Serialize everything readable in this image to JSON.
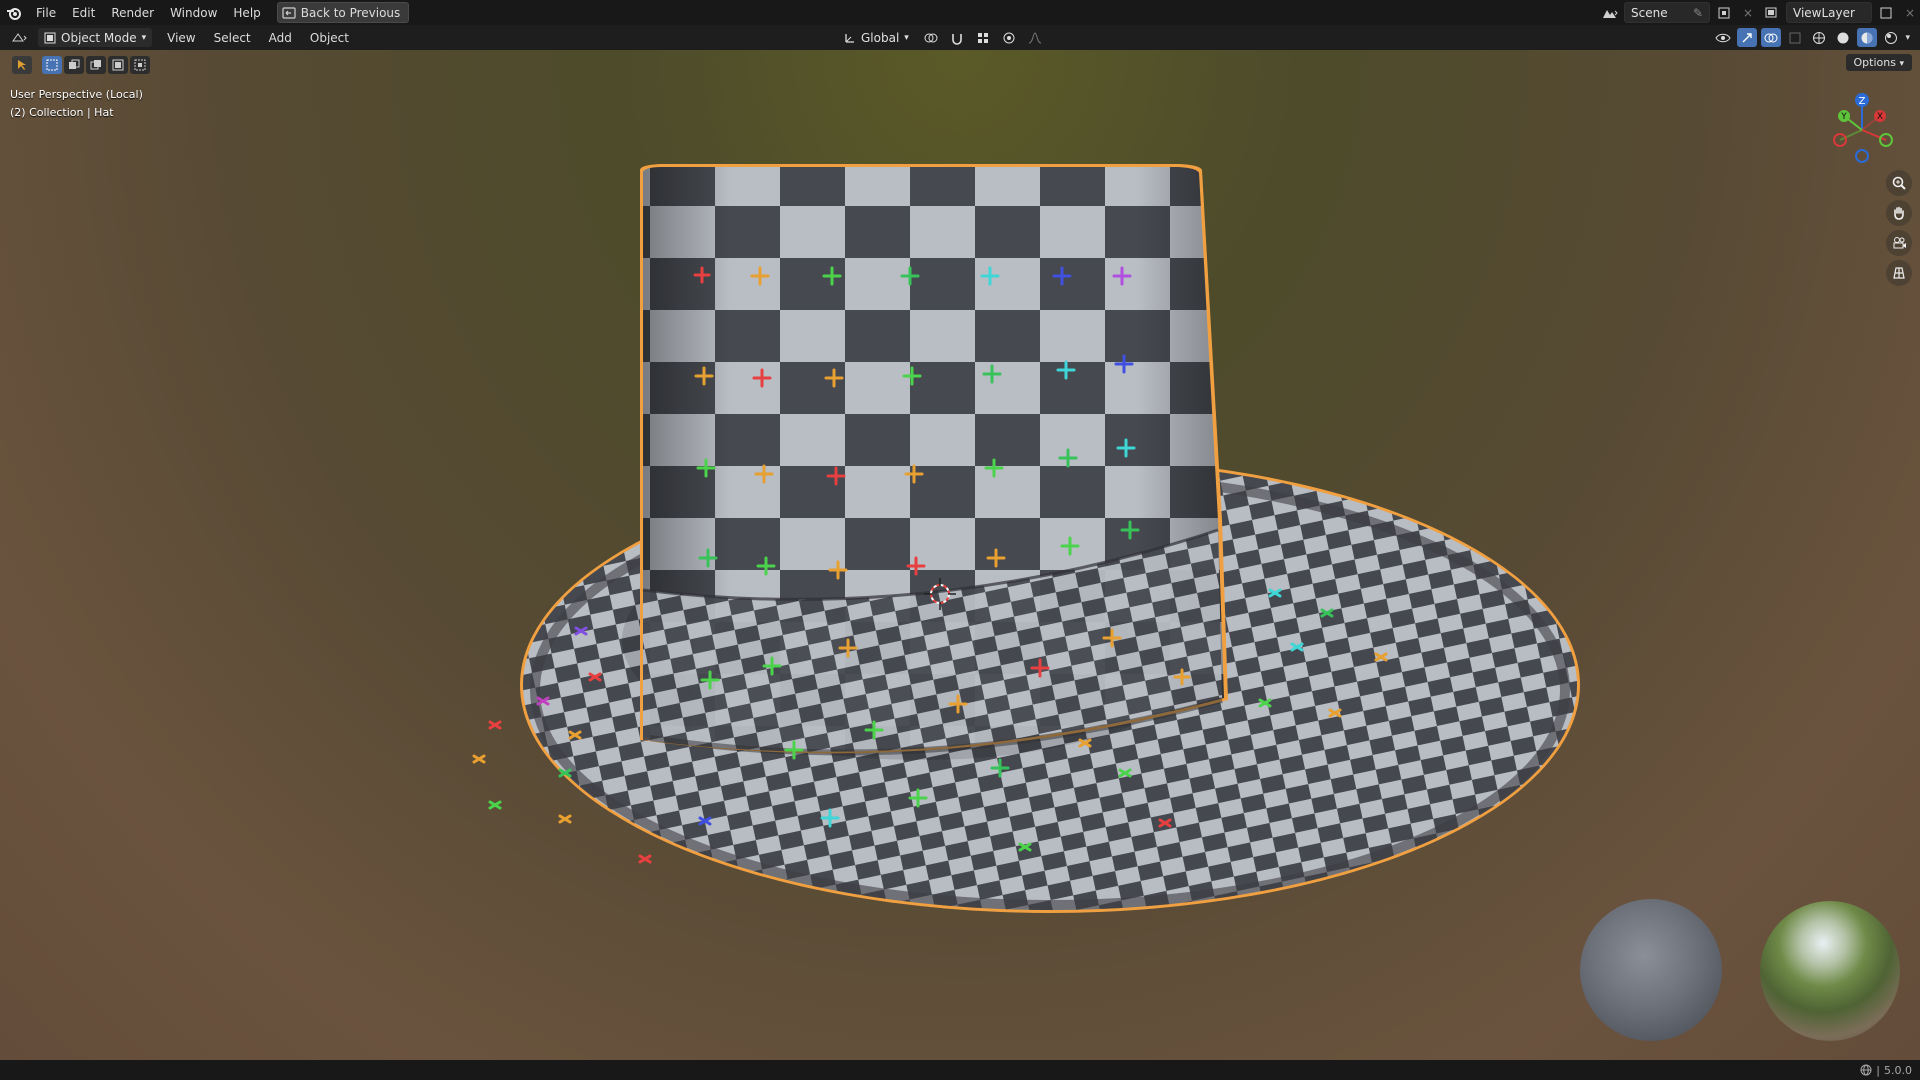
{
  "topbar": {
    "menus": [
      "File",
      "Edit",
      "Render",
      "Window",
      "Help"
    ],
    "back_label": "Back to Previous",
    "scene_name": "Scene",
    "view_layer": "ViewLayer"
  },
  "header": {
    "mode": "Object Mode",
    "menus": [
      "View",
      "Select",
      "Add",
      "Object"
    ],
    "transform_orientation": "Global"
  },
  "viewport": {
    "perspective_label": "User Perspective (Local)",
    "collection_label": "(2) Collection | Hat",
    "options_label": "Options",
    "gizmo_axes": [
      "Z",
      "Y",
      "X"
    ]
  },
  "statusbar": {
    "version": "5.0.0"
  },
  "colors": {
    "accent": "#4772b3",
    "selection_outline": "#f0a040",
    "checker_light": "#b8bcc3",
    "checker_dark": "#45484e"
  },
  "icons": {
    "logo": "blender-logo-icon",
    "back": "back-screen-icon",
    "zoom": "zoom-icon",
    "pan": "hand-icon",
    "camera": "camera-icon",
    "grid": "ortho-grid-icon"
  }
}
